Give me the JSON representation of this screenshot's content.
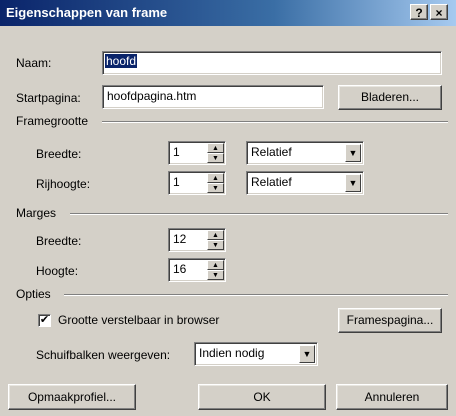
{
  "window": {
    "title": "Eigenschappen van frame",
    "help_button": "?",
    "close_button": "×"
  },
  "name_field": {
    "label": "Naam:",
    "value": "hoofd"
  },
  "start_field": {
    "label": "Startpagina:",
    "value": "hoofdpagina.htm",
    "browse_button": "Bladeren..."
  },
  "framegrootte": {
    "group_label": "Framegrootte",
    "breedte": {
      "label": "Breedte:",
      "value": "1",
      "unit": "Relatief"
    },
    "rijhoogte": {
      "label": "Rijhoogte:",
      "value": "1",
      "unit": "Relatief"
    }
  },
  "marges": {
    "group_label": "Marges",
    "breedte": {
      "label": "Breedte:",
      "value": "12"
    },
    "hoogte": {
      "label": "Hoogte:",
      "value": "16"
    }
  },
  "opties": {
    "group_label": "Opties",
    "resizable_label": "Grootte verstelbaar in browser",
    "resizable_checked": true,
    "check_mark": "✔",
    "framespagina_button": "Framespagina...",
    "scrollbars_label": "Schuifbalken weergeven:",
    "scrollbars_value": "Indien nodig"
  },
  "footer": {
    "style_button": "Opmaakprofiel...",
    "ok_button": "OK",
    "cancel_button": "Annuleren"
  },
  "icons": {
    "spin_up": "▲",
    "spin_down": "▼",
    "dropdown": "▼"
  }
}
